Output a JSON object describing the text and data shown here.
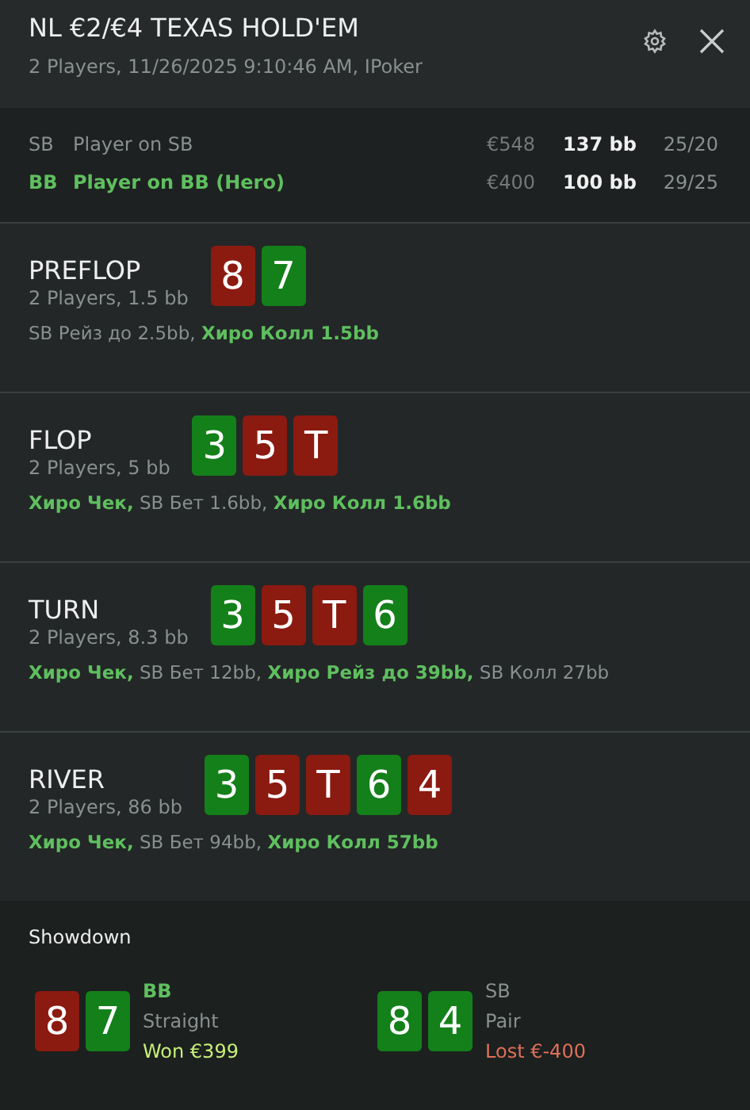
{
  "header": {
    "title": "NL €2/€4 TEXAS HOLD'EM",
    "subtitle": "2 Players, 11/26/2025 9:10:46 AM, IPoker"
  },
  "players": [
    {
      "position": "SB",
      "name": "Player on SB",
      "hero": false,
      "stack": "€548",
      "bb": "137 bb",
      "stats": "25/20"
    },
    {
      "position": "BB",
      "name": "Player on BB (Hero)",
      "hero": true,
      "stack": "€400",
      "bb": "100 bb",
      "stats": "29/25"
    }
  ],
  "streets": [
    {
      "name": "PREFLOP",
      "info": "2 Players, 1.5 bb",
      "cards": [
        {
          "rank": "8",
          "color": "#8b1a10"
        },
        {
          "rank": "7",
          "color": "#14801a"
        }
      ],
      "actions": [
        {
          "text": "SB Рейз до 2.5bb,",
          "hero": false
        },
        {
          "text": "Хиро Колл 1.5bb",
          "hero": true
        }
      ]
    },
    {
      "name": "FLOP",
      "info": "2 Players, 5 bb",
      "cards": [
        {
          "rank": "3",
          "color": "#14801a"
        },
        {
          "rank": "5",
          "color": "#8b1a10"
        },
        {
          "rank": "T",
          "color": "#8b1a10"
        }
      ],
      "actions": [
        {
          "text": "Хиро Чек,",
          "hero": true
        },
        {
          "text": "SB Бет 1.6bb,",
          "hero": false
        },
        {
          "text": "Хиро Колл 1.6bb",
          "hero": true
        }
      ]
    },
    {
      "name": "TURN",
      "info": "2 Players, 8.3 bb",
      "cards": [
        {
          "rank": "3",
          "color": "#14801a"
        },
        {
          "rank": "5",
          "color": "#8b1a10"
        },
        {
          "rank": "T",
          "color": "#8b1a10"
        },
        {
          "rank": "6",
          "color": "#14801a"
        }
      ],
      "actions": [
        {
          "text": "Хиро Чек,",
          "hero": true
        },
        {
          "text": "SB Бет 12bb,",
          "hero": false
        },
        {
          "text": "Хиро Рейз до 39bb,",
          "hero": true
        },
        {
          "text": "SB Колл 27bb",
          "hero": false
        }
      ]
    },
    {
      "name": "RIVER",
      "info": "2 Players, 86 bb",
      "cards": [
        {
          "rank": "3",
          "color": "#14801a"
        },
        {
          "rank": "5",
          "color": "#8b1a10"
        },
        {
          "rank": "T",
          "color": "#8b1a10"
        },
        {
          "rank": "6",
          "color": "#14801a"
        },
        {
          "rank": "4",
          "color": "#8b1a10"
        }
      ],
      "actions": [
        {
          "text": "Хиро Чек,",
          "hero": true
        },
        {
          "text": "SB Бет 94bb,",
          "hero": false
        },
        {
          "text": "Хиро Колл 57bb",
          "hero": true
        }
      ]
    }
  ],
  "showdown": {
    "title": "Showdown",
    "hands": [
      {
        "position": "BB",
        "hero": true,
        "cards": [
          {
            "rank": "8",
            "color": "#8b1a10"
          },
          {
            "rank": "7",
            "color": "#14801a"
          }
        ],
        "hand": "Straight",
        "won": true,
        "result": "Won €399"
      },
      {
        "position": "SB",
        "hero": false,
        "cards": [
          {
            "rank": "8",
            "color": "#14801a"
          },
          {
            "rank": "4",
            "color": "#14801a"
          }
        ],
        "hand": "Pair",
        "won": false,
        "result": "Lost €-400"
      }
    ]
  }
}
